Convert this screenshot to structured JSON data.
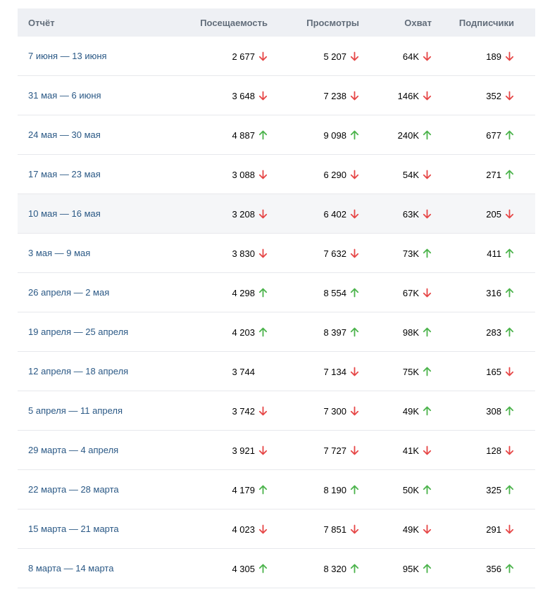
{
  "colors": {
    "header_bg": "#eef0f4",
    "header_text": "#626d7a",
    "link": "#2a5885",
    "up": "#4bb34b",
    "down": "#e64646",
    "divider": "#e7e8ec"
  },
  "header": {
    "report": "Отчёт",
    "visits": "Посещаемость",
    "views": "Просмотры",
    "reach": "Охват",
    "subscribers": "Подписчики"
  },
  "rows": [
    {
      "period": "7 июня — 13 июня",
      "visits": "2 677",
      "visits_trend": "down",
      "views": "5 207",
      "views_trend": "down",
      "reach": "64K",
      "reach_trend": "down",
      "subscribers": "189",
      "subscribers_trend": "down"
    },
    {
      "period": "31 мая — 6 июня",
      "visits": "3 648",
      "visits_trend": "down",
      "views": "7 238",
      "views_trend": "down",
      "reach": "146K",
      "reach_trend": "down",
      "subscribers": "352",
      "subscribers_trend": "down"
    },
    {
      "period": "24 мая — 30 мая",
      "visits": "4 887",
      "visits_trend": "up",
      "views": "9 098",
      "views_trend": "up",
      "reach": "240K",
      "reach_trend": "up",
      "subscribers": "677",
      "subscribers_trend": "up"
    },
    {
      "period": "17 мая — 23 мая",
      "visits": "3 088",
      "visits_trend": "down",
      "views": "6 290",
      "views_trend": "down",
      "reach": "54K",
      "reach_trend": "down",
      "subscribers": "271",
      "subscribers_trend": "up"
    },
    {
      "period": "10 мая — 16 мая",
      "visits": "3 208",
      "visits_trend": "down",
      "views": "6 402",
      "views_trend": "down",
      "reach": "63K",
      "reach_trend": "down",
      "subscribers": "205",
      "subscribers_trend": "down",
      "hover": true
    },
    {
      "period": "3 мая — 9 мая",
      "visits": "3 830",
      "visits_trend": "down",
      "views": "7 632",
      "views_trend": "down",
      "reach": "73K",
      "reach_trend": "up",
      "subscribers": "411",
      "subscribers_trend": "up"
    },
    {
      "period": "26 апреля — 2 мая",
      "visits": "4 298",
      "visits_trend": "up",
      "views": "8 554",
      "views_trend": "up",
      "reach": "67K",
      "reach_trend": "down",
      "subscribers": "316",
      "subscribers_trend": "up"
    },
    {
      "period": "19 апреля — 25 апреля",
      "visits": "4 203",
      "visits_trend": "up",
      "views": "8 397",
      "views_trend": "up",
      "reach": "98K",
      "reach_trend": "up",
      "subscribers": "283",
      "subscribers_trend": "up"
    },
    {
      "period": "12 апреля — 18 апреля",
      "visits": "3 744",
      "visits_trend": "none",
      "views": "7 134",
      "views_trend": "down",
      "reach": "75K",
      "reach_trend": "up",
      "subscribers": "165",
      "subscribers_trend": "down"
    },
    {
      "period": "5 апреля — 11 апреля",
      "visits": "3 742",
      "visits_trend": "down",
      "views": "7 300",
      "views_trend": "down",
      "reach": "49K",
      "reach_trend": "up",
      "subscribers": "308",
      "subscribers_trend": "up"
    },
    {
      "period": "29 марта — 4 апреля",
      "visits": "3 921",
      "visits_trend": "down",
      "views": "7 727",
      "views_trend": "down",
      "reach": "41K",
      "reach_trend": "down",
      "subscribers": "128",
      "subscribers_trend": "down"
    },
    {
      "period": "22 марта — 28 марта",
      "visits": "4 179",
      "visits_trend": "up",
      "views": "8 190",
      "views_trend": "up",
      "reach": "50K",
      "reach_trend": "up",
      "subscribers": "325",
      "subscribers_trend": "up"
    },
    {
      "period": "15 марта — 21 марта",
      "visits": "4 023",
      "visits_trend": "down",
      "views": "7 851",
      "views_trend": "down",
      "reach": "49K",
      "reach_trend": "down",
      "subscribers": "291",
      "subscribers_trend": "down"
    },
    {
      "period": "8 марта — 14 марта",
      "visits": "4 305",
      "visits_trend": "up",
      "views": "8 320",
      "views_trend": "up",
      "reach": "95K",
      "reach_trend": "up",
      "subscribers": "356",
      "subscribers_trend": "up"
    }
  ]
}
